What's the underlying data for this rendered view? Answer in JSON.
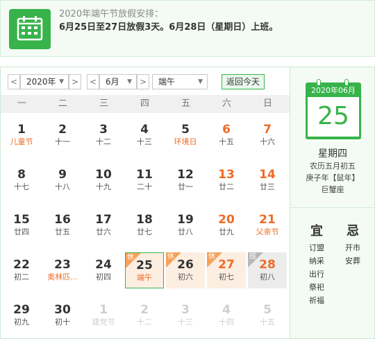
{
  "notice": {
    "title": "2020年端午节放假安排：",
    "body": "6月25日至27日放假3天。6月28日（星期日）上班。",
    "icon": "calendar-icon"
  },
  "toolbar": {
    "prev_year": "<",
    "year": "2020年",
    "next_year": ">",
    "prev_month": "<",
    "month": "6月",
    "next_month": ">",
    "holiday": "端午",
    "today": "返回今天"
  },
  "weekdays": [
    "一",
    "二",
    "三",
    "四",
    "五",
    "六",
    "日"
  ],
  "weeks": [
    [
      {
        "day": "1",
        "lunar": "儿童节",
        "weekend": false,
        "fest": true
      },
      {
        "day": "2",
        "lunar": "十一"
      },
      {
        "day": "3",
        "lunar": "十二"
      },
      {
        "day": "4",
        "lunar": "十三"
      },
      {
        "day": "5",
        "lunar": "环境日",
        "fest": true
      },
      {
        "day": "6",
        "lunar": "十五",
        "weekend": true
      },
      {
        "day": "7",
        "lunar": "十六",
        "weekend": true
      }
    ],
    [
      {
        "day": "8",
        "lunar": "十七"
      },
      {
        "day": "9",
        "lunar": "十八"
      },
      {
        "day": "10",
        "lunar": "十九"
      },
      {
        "day": "11",
        "lunar": "二十"
      },
      {
        "day": "12",
        "lunar": "廿一"
      },
      {
        "day": "13",
        "lunar": "廿二",
        "weekend": true
      },
      {
        "day": "14",
        "lunar": "廿三",
        "weekend": true
      }
    ],
    [
      {
        "day": "15",
        "lunar": "廿四"
      },
      {
        "day": "16",
        "lunar": "廿五"
      },
      {
        "day": "17",
        "lunar": "廿六"
      },
      {
        "day": "18",
        "lunar": "廿七"
      },
      {
        "day": "19",
        "lunar": "廿八"
      },
      {
        "day": "20",
        "lunar": "廿九",
        "weekend": true
      },
      {
        "day": "21",
        "lunar": "父亲节",
        "weekend": true,
        "fest": true
      }
    ],
    [
      {
        "day": "22",
        "lunar": "初二"
      },
      {
        "day": "23",
        "lunar": "奥林匹...",
        "fest": true
      },
      {
        "day": "24",
        "lunar": "初四"
      },
      {
        "day": "25",
        "lunar": "端午",
        "fest": true,
        "holiday": true,
        "selected": true,
        "tag": "休"
      },
      {
        "day": "26",
        "lunar": "初六",
        "holiday": true,
        "tag": "休"
      },
      {
        "day": "27",
        "lunar": "初七",
        "weekend": true,
        "holiday": true,
        "tag": "休"
      },
      {
        "day": "28",
        "lunar": "初八",
        "weekend": true,
        "workday": true,
        "tag": "班"
      }
    ],
    [
      {
        "day": "29",
        "lunar": "初九"
      },
      {
        "day": "30",
        "lunar": "初十"
      },
      {
        "day": "1",
        "lunar": "建党节",
        "other": true
      },
      {
        "day": "2",
        "lunar": "十二",
        "other": true
      },
      {
        "day": "3",
        "lunar": "十三",
        "other": true
      },
      {
        "day": "4",
        "lunar": "十四",
        "other": true
      },
      {
        "day": "5",
        "lunar": "十五",
        "other": true
      }
    ]
  ],
  "detail": {
    "month_header": "2020年06月",
    "day": "25",
    "weekday": "星期四",
    "lunar": "农历五月初五",
    "ganzhi": "庚子年【鼠年】",
    "constellation": "巨蟹座",
    "yi_label": "宜",
    "ji_label": "忌",
    "yi": [
      "订盟",
      "纳采",
      "出行",
      "祭祀",
      "祈福"
    ],
    "ji": [
      "开市",
      "安葬"
    ]
  },
  "colors": {
    "brand_green": "#37b34a",
    "accent_orange": "#ee6b27",
    "holiday_bg": "#fdeee2"
  }
}
